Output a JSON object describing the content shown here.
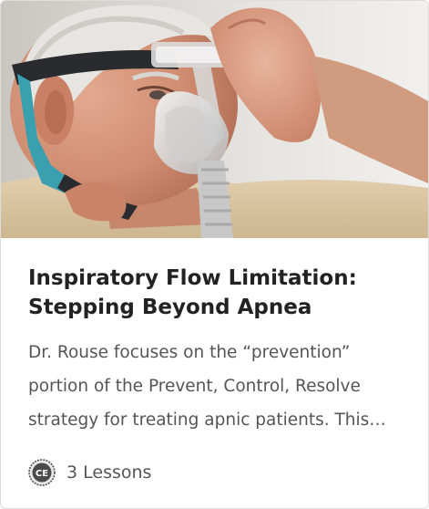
{
  "card": {
    "title": "Inspiratory Flow Limitation: Stepping Beyond Apnea",
    "description": "Dr. Rouse focuses on the “prevention” portion of the Prevent, Control, Resolve strategy for treating apnic patients. This…",
    "badge_text": "CE",
    "lessons_label": "3 Lessons"
  },
  "colors": {
    "title": "#222222",
    "body_text": "#555555",
    "badge": "#4a4a4a",
    "border": "#dddddd"
  },
  "icons": {
    "badge": "ce-credit-icon"
  }
}
